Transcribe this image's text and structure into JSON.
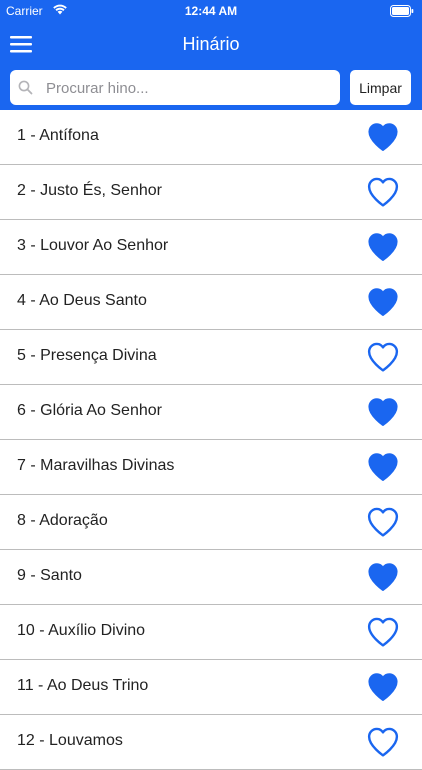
{
  "status_bar": {
    "carrier": "Carrier",
    "time": "12:44 AM"
  },
  "header": {
    "title": "Hinário"
  },
  "search": {
    "placeholder": "Procurar hino...",
    "value": "",
    "clear_label": "Limpar"
  },
  "colors": {
    "accent": "#1a66f0",
    "heart": "#1a66f0",
    "divider": "#bcbcbc"
  },
  "hymns": [
    {
      "label": "1 - Antífona",
      "favorite": true
    },
    {
      "label": "2 - Justo És, Senhor",
      "favorite": false
    },
    {
      "label": "3 - Louvor Ao Senhor",
      "favorite": true
    },
    {
      "label": "4 - Ao Deus Santo",
      "favorite": true
    },
    {
      "label": "5 - Presença Divina",
      "favorite": false
    },
    {
      "label": "6 - Glória Ao Senhor",
      "favorite": true
    },
    {
      "label": "7 - Maravilhas Divinas",
      "favorite": true
    },
    {
      "label": "8 - Adoração",
      "favorite": false
    },
    {
      "label": "9 - Santo",
      "favorite": true
    },
    {
      "label": "10 - Auxílio Divino",
      "favorite": false
    },
    {
      "label": "11 - Ao Deus Trino",
      "favorite": true
    },
    {
      "label": "12 - Louvamos",
      "favorite": false
    }
  ]
}
